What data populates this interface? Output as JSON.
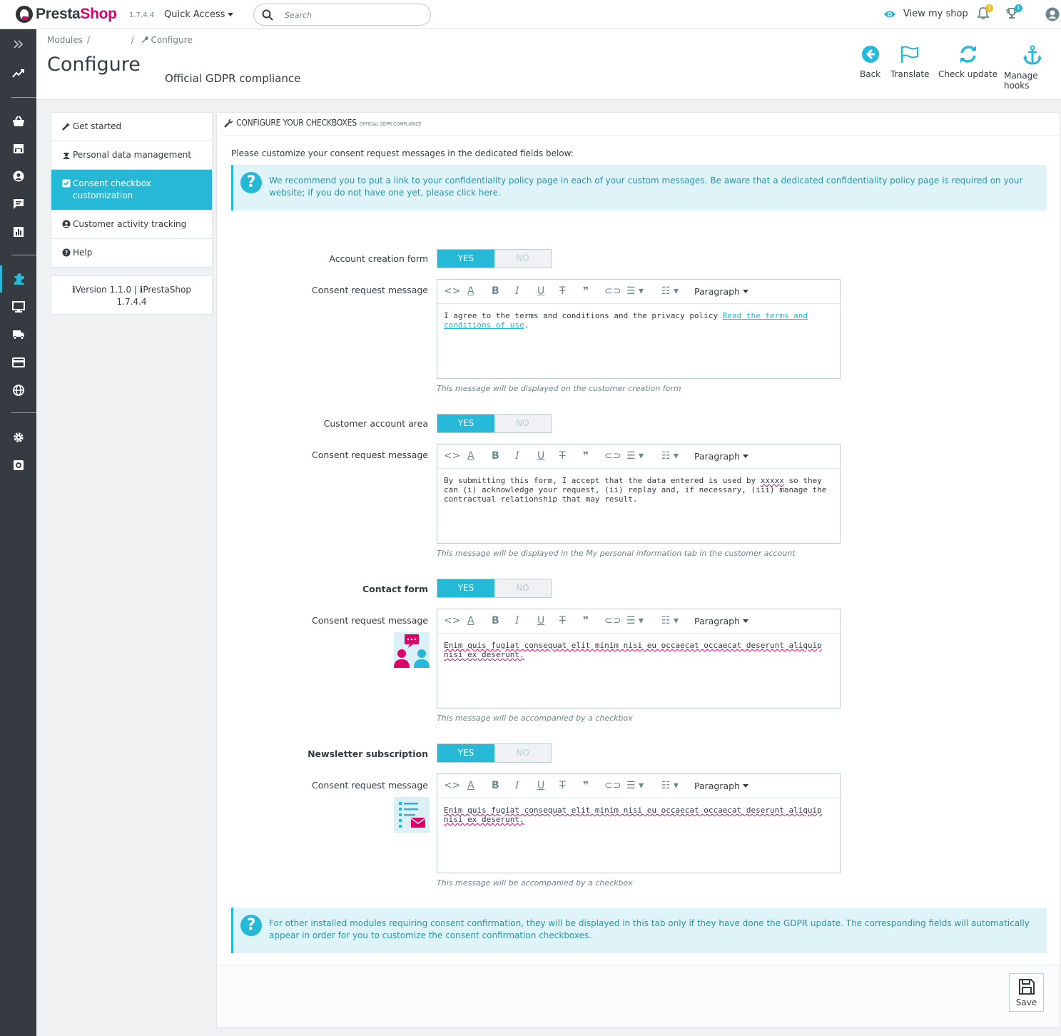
{
  "header": {
    "logo_text_1": "Presta",
    "logo_text_2": "Shop",
    "version": "1.7.4.4",
    "quick_access": "Quick Access",
    "search_placeholder": "Search",
    "view_shop": "View my shop",
    "notifications_count": "1",
    "trophy_count": "1"
  },
  "breadcrumb": {
    "item1": "Modules",
    "sep": "/",
    "item3": "Configure"
  },
  "page": {
    "title": "Configure",
    "subtitle": "Official GDPR compliance"
  },
  "toolbar": {
    "back": "Back",
    "translate": "Translate",
    "check_update": "Check update",
    "manage_hooks": "Manage hooks"
  },
  "left_menu": {
    "items": [
      {
        "label": "Get started"
      },
      {
        "label": "Personal data management"
      },
      {
        "label": "Consent checkbox customization"
      },
      {
        "label": "Customer activity tracking"
      },
      {
        "label": "Help"
      }
    ],
    "version_line1": "Version 1.1.0 |",
    "version_line2": "PrestaShop",
    "version_line3": "1.7.4.4"
  },
  "panel": {
    "heading": "Configure your checkboxes",
    "heading_small": "Official GDPR compliance",
    "intro": "Please customize your consent request messages in the dedicated fields below:",
    "alert_top": "We recommend you to put a link to your confidentiality policy page in each of your custom messages. Be aware that a dedicated confidentiality policy page is required on your website; if you do not have one yet, please click here.",
    "alert_bottom": "For other installed modules requiring consent confirmation, they will be displayed in this tab only if they have done the GDPR update. The corresponding fields will automatically appear in order for you to customize the consent confirmation checkboxes.",
    "yes": "YES",
    "no": "NO",
    "consent_label": "Consent request message",
    "paragraph": "Paragraph",
    "sections": [
      {
        "label": "Account creation form",
        "text": "I agree to the terms and conditions and the privacy policy",
        "link": "Read the terms and conditions of use",
        "after_link": ".",
        "hint": "This message will be displayed on the customer creation form"
      },
      {
        "label": "Customer account area",
        "text_a": "By submitting this form, I accept that the data entered is used by ",
        "text_b": "xxxxx",
        "text_c": " so they can (i) acknowledge your request, (ii) replay and, if necessary, (iii) manage the contractual relationship that may result.",
        "hint": "This message will be displayed in the My personal information tab in the customer account"
      },
      {
        "label": "Contact form",
        "text": "Enim quis fugiat consequat elit minim nisi eu occaecat occaecat deserunt aliquip nisi ex deserunt.",
        "hint": "This message will be accompanied by a checkbox"
      },
      {
        "label": "Newsletter subscription",
        "text": "Enim quis fugiat consequat elit minim nisi eu occaecat occaecat deserunt aliquip nisi ex deserunt.",
        "hint": "This message will be accompanied by a checkbox"
      }
    ],
    "save": "Save"
  },
  "colors": {
    "primary": "#25b9d7",
    "sidebar": "#363a41",
    "brand_pink": "#df0067",
    "alert_bg": "#dff4f8",
    "badge_orange": "#fbbb22"
  },
  "icons": {
    "sidebar": [
      "expand-icon",
      "dashboard-icon",
      "orders-icon",
      "catalog-icon",
      "customers-icon",
      "messages-icon",
      "stats-icon",
      "modules-icon",
      "design-icon",
      "shipping-icon",
      "payment-icon",
      "international-icon",
      "settings-icon",
      "advanced-icon"
    ]
  }
}
